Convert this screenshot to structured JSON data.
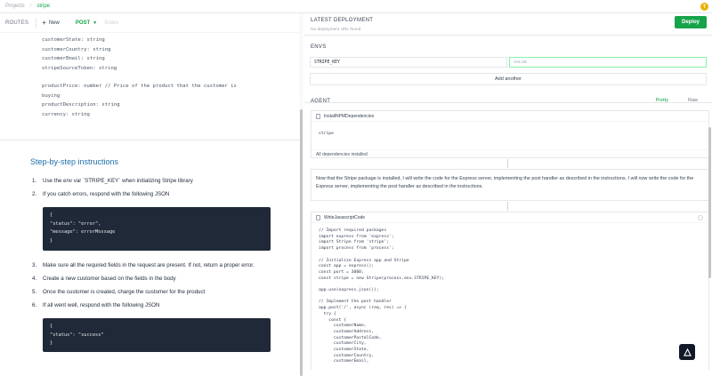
{
  "breadcrumb": {
    "projects": "Projects",
    "separator": "/",
    "current": "stripe"
  },
  "avatar": {
    "initial": "T",
    "color": "#eab308"
  },
  "routes": {
    "label": "ROUTES",
    "new_label": "New",
    "method": "POST",
    "path": "/index"
  },
  "doc": {
    "code_lines_a": [
      "customerState: string",
      "customerCountry: string",
      "customerEmail: string",
      "stripeSourceToken: string"
    ],
    "code_lines_b": [
      "productPrice: number // Price of the product that the customer is",
      "buying",
      "productDescription: string",
      "currency: string"
    ],
    "steps_title": "Step-by-step instructions",
    "steps": [
      {
        "num": "1.",
        "text": "Use the env var `STRIPE_KEY` when initializing Stripe library"
      },
      {
        "num": "2.",
        "text": "If you catch errors, respond with the following JSON"
      },
      {
        "num": "3.",
        "text": "Make sure all the required fields in the request are present. If not, return a proper error."
      },
      {
        "num": "4.",
        "text": "Create a new customer based on the fields in the body"
      },
      {
        "num": "5.",
        "text": "Once the customer is created, charge the customer for the product"
      },
      {
        "num": "6.",
        "text": "If all went well, respond with the following JSON"
      }
    ],
    "json_error": [
      "{",
      "  \"status\": \"error\",",
      "  \"message\": errorMessage",
      "}"
    ],
    "json_success": [
      "{",
      "  \"status\": \"success\"",
      "}"
    ]
  },
  "deployment": {
    "title": "LATEST DEPLOYMENT",
    "sub": "No deployment URL found",
    "deploy_label": "Deploy",
    "accent": "#16a34a"
  },
  "envs": {
    "title": "ENVS",
    "key": "STRIPE_KEY",
    "value_placeholder": "VALUE",
    "add_label": "Add another"
  },
  "agent": {
    "title": "AGENT",
    "tab_pretty": "Pretty",
    "tab_raw": "Raw",
    "install_card": {
      "title": "InstallNPMDependencies",
      "package": "stripe",
      "footer": "All dependencies installed"
    },
    "narration": "Now that the Stripe package is installed, I will write the code for the Express server, implementing the post handler as described in the instructions. I will now write the code for the Express server, implementing the post handler as described in the instructions.",
    "write_card": {
      "title": "WriteJavascriptCode",
      "code": [
        "// Import required packages",
        "import express from 'express';",
        "import Stripe from 'stripe';",
        "import process from 'process';",
        "",
        "// Initialize Express app and Stripe",
        "const app = express();",
        "const port = 3000;",
        "const stripe = new Stripe(process.env.STRIPE_KEY);",
        "",
        "app.use(express.json());",
        "",
        "// Implement the post handler",
        "app.post('/', async (req, res) => {",
        "  try {",
        "    const {",
        "      customerName,",
        "      customerAddress,",
        "      customerPostalCode,",
        "      customerCity,",
        "      customerState,",
        "      customerCountry,",
        "      customerEmail,"
      ]
    }
  }
}
